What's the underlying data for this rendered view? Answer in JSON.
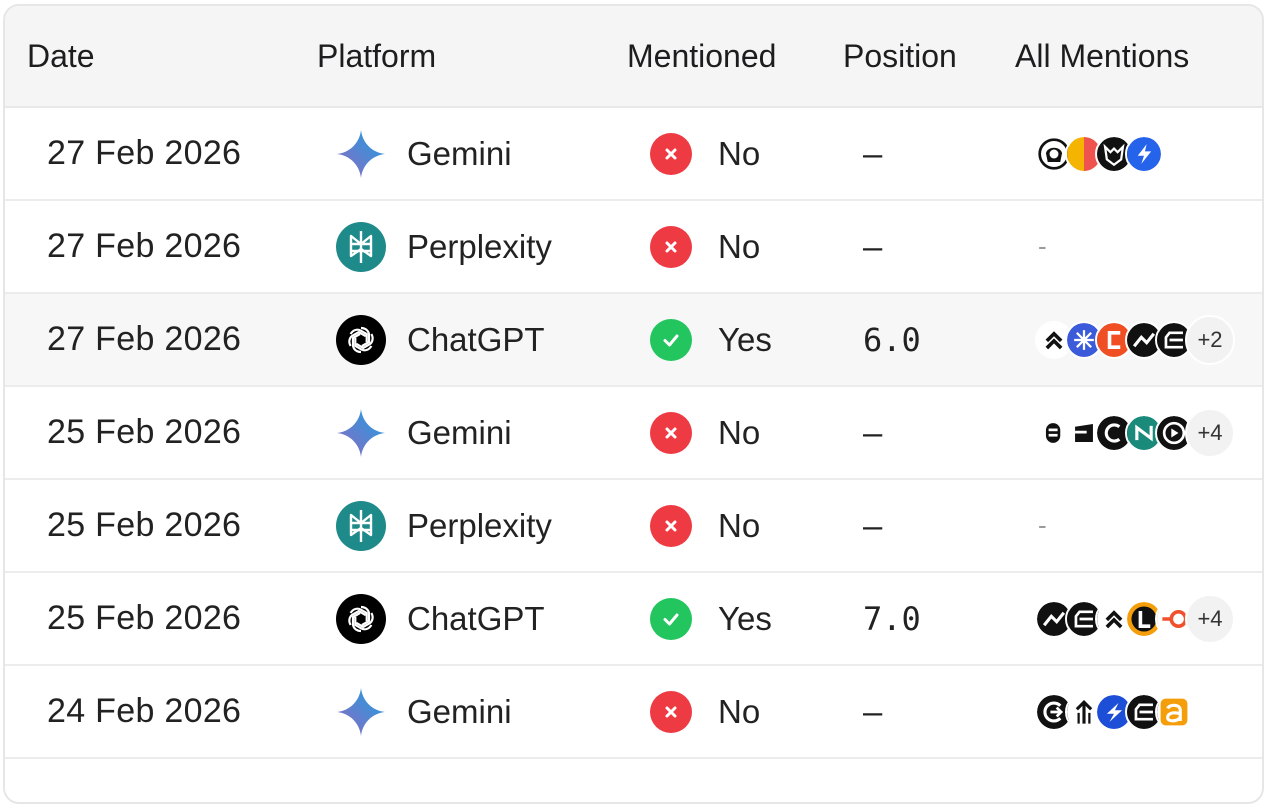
{
  "columns": {
    "date": "Date",
    "platform": "Platform",
    "mentioned": "Mentioned",
    "position": "Position",
    "all_mentions": "All Mentions"
  },
  "colors": {
    "no": "#ee3a43",
    "yes": "#22c55e",
    "perplexity": "#1f8a8a",
    "chatgpt": "#000000"
  },
  "rows": [
    {
      "date": "27 Feb 2026",
      "platform": "Gemini",
      "platform_icon": "gemini-icon",
      "mentioned": "No",
      "status": "no",
      "position": "–",
      "mentions": [
        "face-logo",
        "orange-logo",
        "fox-logo",
        "bolt-logo"
      ],
      "more": ""
    },
    {
      "date": "27 Feb 2026",
      "platform": "Perplexity",
      "platform_icon": "perplexity-icon",
      "mentioned": "No",
      "status": "no",
      "position": "–",
      "mentions": [],
      "mentions_empty": "-",
      "more": ""
    },
    {
      "date": "27 Feb 2026",
      "platform": "ChatGPT",
      "platform_icon": "chatgpt-icon",
      "mentioned": "Yes",
      "status": "yes",
      "position": "6.0",
      "mentions": [
        "chevron-logo",
        "blue-star-logo",
        "orange-c-logo",
        "black-wave-logo",
        "black-e-logo"
      ],
      "more": "+2"
    },
    {
      "date": "25 Feb 2026",
      "platform": "Gemini",
      "platform_icon": "gemini-icon",
      "mentioned": "No",
      "status": "no",
      "position": "–",
      "mentions": [
        "mask-logo",
        "black-block-logo",
        "black-c-logo",
        "teal-n-logo",
        "black-play-logo"
      ],
      "more": "+4"
    },
    {
      "date": "25 Feb 2026",
      "platform": "Perplexity",
      "platform_icon": "perplexity-icon",
      "mentioned": "No",
      "status": "no",
      "position": "–",
      "mentions": [],
      "mentions_empty": "-",
      "more": ""
    },
    {
      "date": "25 Feb 2026",
      "platform": "ChatGPT",
      "platform_icon": "chatgpt-icon",
      "mentioned": "Yes",
      "status": "yes",
      "position": "7.0",
      "mentions": [
        "black-wave-logo",
        "black-e-logo",
        "chevron-logo",
        "orange-l-logo",
        "orange-ring-logo"
      ],
      "more": "+4"
    },
    {
      "date": "24 Feb 2026",
      "platform": "Gemini",
      "platform_icon": "gemini-icon",
      "mentioned": "No",
      "status": "no",
      "position": "–",
      "mentions": [
        "black-arrow-logo",
        "arrow-up-logo",
        "blue-bolt-logo",
        "black-e-logo",
        "orange-a-logo"
      ],
      "more": ""
    }
  ]
}
